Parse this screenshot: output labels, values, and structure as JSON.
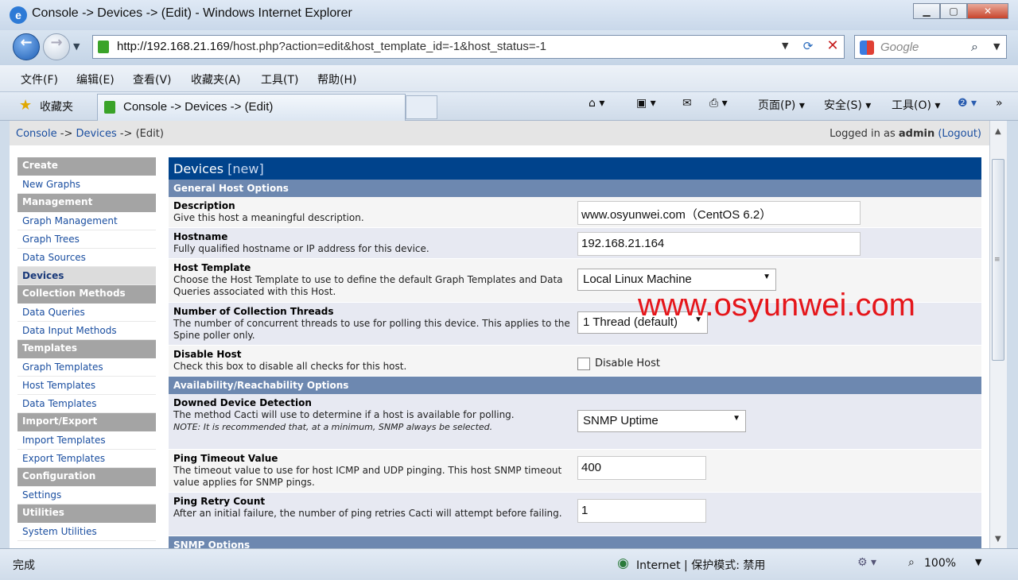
{
  "window": {
    "title": "Console -> Devices -> (Edit) - Windows Internet Explorer",
    "buttons": [
      "▁",
      "▢",
      "✕"
    ]
  },
  "navbar": {
    "url_host": "http://192.168.21.169",
    "url_rest": "/host.php?action=edit&host_template_id=-1&host_status=-1",
    "search_placeholder": "Google"
  },
  "menubar": [
    "文件(F)",
    "编辑(E)",
    "查看(V)",
    "收藏夹(A)",
    "工具(T)",
    "帮助(H)"
  ],
  "favbar": {
    "favorites_label": "收藏夹",
    "tab_title": "Console -> Devices -> (Edit)",
    "commands": {
      "page": "页面(P) ▾",
      "safety": "安全(S) ▾",
      "tools": "工具(O) ▾",
      "more": "»"
    }
  },
  "breadcrumb": {
    "console": "Console",
    "sep1": "->",
    "devices": "Devices",
    "rest": "-> (Edit)",
    "logged_in_prefix": "Logged in as",
    "user": "admin",
    "logout": "(Logout)"
  },
  "menu": [
    {
      "type": "header",
      "label": "Create"
    },
    {
      "type": "item",
      "label": "New Graphs"
    },
    {
      "type": "header",
      "label": "Management"
    },
    {
      "type": "item",
      "label": "Graph Management"
    },
    {
      "type": "item",
      "label": "Graph Trees"
    },
    {
      "type": "item",
      "label": "Data Sources"
    },
    {
      "type": "item",
      "label": "Devices",
      "selected": true
    },
    {
      "type": "header",
      "label": "Collection Methods"
    },
    {
      "type": "item",
      "label": "Data Queries"
    },
    {
      "type": "item",
      "label": "Data Input Methods"
    },
    {
      "type": "header",
      "label": "Templates"
    },
    {
      "type": "item",
      "label": "Graph Templates"
    },
    {
      "type": "item",
      "label": "Host Templates"
    },
    {
      "type": "item",
      "label": "Data Templates"
    },
    {
      "type": "header",
      "label": "Import/Export"
    },
    {
      "type": "item",
      "label": "Import Templates"
    },
    {
      "type": "item",
      "label": "Export Templates"
    },
    {
      "type": "header",
      "label": "Configuration"
    },
    {
      "type": "item",
      "label": "Settings"
    },
    {
      "type": "header",
      "label": "Utilities"
    },
    {
      "type": "item",
      "label": "System Utilities"
    }
  ],
  "form": {
    "title": "Devices",
    "title_suffix": "[new]",
    "section1": "General Host Options",
    "description": {
      "label": "Description",
      "help": "Give this host a meaningful description.",
      "value": "www.osyunwei.com（CentOS 6.2）"
    },
    "hostname": {
      "label": "Hostname",
      "help": "Fully qualified hostname or IP address for this device.",
      "value": "192.168.21.164"
    },
    "host_template": {
      "label": "Host Template",
      "help": "Choose the Host Template to use to define the default Graph Templates and Data Queries associated with this Host.",
      "value": "Local Linux Machine"
    },
    "threads": {
      "label": "Number of Collection Threads",
      "help": "The number of concurrent threads to use for polling this device. This applies to the Spine poller only.",
      "value": "1 Thread (default)"
    },
    "disable": {
      "label": "Disable Host",
      "help": "Check this box to disable all checks for this host.",
      "checkbox_label": "Disable Host"
    },
    "section2": "Availability/Reachability Options",
    "downed": {
      "label": "Downed Device Detection",
      "help": "The method Cacti will use to determine if a host is available for polling.",
      "note": "NOTE: It is recommended that, at a minimum, SNMP always be selected.",
      "value": "SNMP Uptime"
    },
    "ping_timeout": {
      "label": "Ping Timeout Value",
      "help": "The timeout value to use for host ICMP and UDP pinging. This host SNMP timeout value applies for SNMP pings.",
      "value": "400"
    },
    "ping_retry": {
      "label": "Ping Retry Count",
      "help": "After an initial failure, the number of ping retries Cacti will attempt before failing.",
      "value": "1"
    },
    "section3": "SNMP Options"
  },
  "watermark": "www.osyunwei.com",
  "statusbar": {
    "done": "完成",
    "zone": "Internet | 保护模式: 禁用",
    "zoom": "100%"
  }
}
